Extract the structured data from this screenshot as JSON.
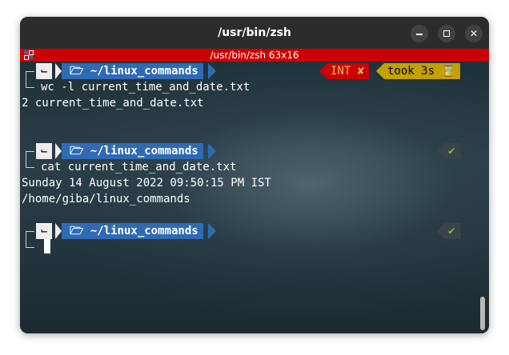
{
  "window": {
    "title": "/usr/bin/zsh",
    "buttons": {
      "minimize": "minimize",
      "maximize": "maximize",
      "close": "✕"
    }
  },
  "tmux": {
    "status": "/usr/bin/zsh 63x16"
  },
  "prompt": {
    "os_glyph": "⌙",
    "folder_glyph": "🗡",
    "directory": "~/linux_commands"
  },
  "blocks": [
    {
      "command": "wc -l current_time_and_date.txt",
      "output": [
        "2 current_time_and_date.txt"
      ],
      "status": {
        "int_label": "INT",
        "int_mark": "✘",
        "took_label": "took 3s",
        "took_icon": "⌛"
      }
    },
    {
      "command": "cat current_time_and_date.txt",
      "output": [
        "Sunday 14 August 2022 09:50:15 PM IST",
        "/home/giba/linux_commands"
      ],
      "status": {
        "ok_mark": "✔"
      }
    },
    {
      "command": "",
      "output": [],
      "status": {
        "ok_mark": "✔"
      }
    }
  ],
  "colors": {
    "tmux_bar": "#cc0000",
    "dir_segment": "#2f6bb4",
    "int_segment": "#cc0000",
    "took_segment": "#c4a000",
    "ok_check": "#5fd700"
  }
}
